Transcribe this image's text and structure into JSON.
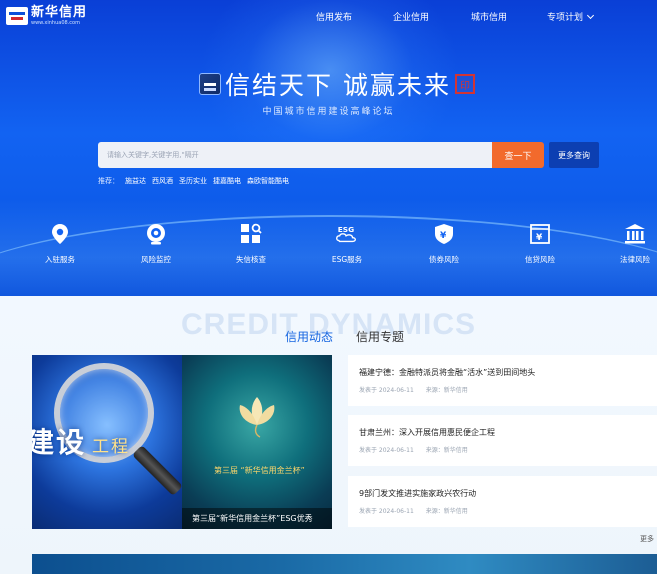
{
  "logo": {
    "title": "新华信用",
    "subtitle": "www.xinhua08.com"
  },
  "nav": {
    "items": [
      "信用发布",
      "企业信用",
      "城市信用"
    ],
    "dropdown": "专项计划"
  },
  "hero": {
    "slogan": "信结天下 诚赢未来",
    "seal": "印",
    "subtitle": "中国城市信用建设高峰论坛"
  },
  "search": {
    "placeholder": "请输入关键字,关键字用,\"隔开",
    "button": "查一下",
    "more_button": "更多查询"
  },
  "recommend": {
    "label": "推荐：",
    "items": [
      "施益达",
      "西风酒",
      "圣历实业",
      "捷嘉酷电",
      "森欧智能酷电"
    ]
  },
  "services": [
    {
      "label": "入驻服务",
      "icon": "location-pin-icon"
    },
    {
      "label": "风险监控",
      "icon": "camera-icon"
    },
    {
      "label": "失信核查",
      "icon": "search-grid-icon"
    },
    {
      "label": "ESG服务",
      "icon": "esg-cloud-icon"
    },
    {
      "label": "债券风险",
      "icon": "shield-icon"
    },
    {
      "label": "信贷风险",
      "icon": "yen-document-icon"
    },
    {
      "label": "法律风险",
      "icon": "court-building-icon"
    }
  ],
  "section": {
    "watermark": "CREDIT DYNAMICS",
    "tabs": [
      "信用动态",
      "信用专题"
    ]
  },
  "banner": {
    "slide1_text": "建设",
    "slide1_text_sub": "工程",
    "slide2_caption": "第三届 “新华信用金兰杯”",
    "caption": "第三届“新华信用金兰杯”ESG优秀"
  },
  "news": [
    {
      "title": "福建宁德：金融特派员将金融“活水”送到田间地头",
      "date": "发表于 2024-06-11",
      "source": "来源：新华信用"
    },
    {
      "title": "甘肃兰州：深入开展信用惠民便企工程",
      "date": "发表于 2024-06-11",
      "source": "来源：新华信用"
    },
    {
      "title": "9部门发文推进实施家政兴农行动",
      "date": "发表于 2024-06-11",
      "source": "来源：新华信用"
    }
  ],
  "more_link": "更多",
  "colors": {
    "primary": "#1263f2",
    "accent": "#f26a2c",
    "tab_active": "#1565e0"
  }
}
